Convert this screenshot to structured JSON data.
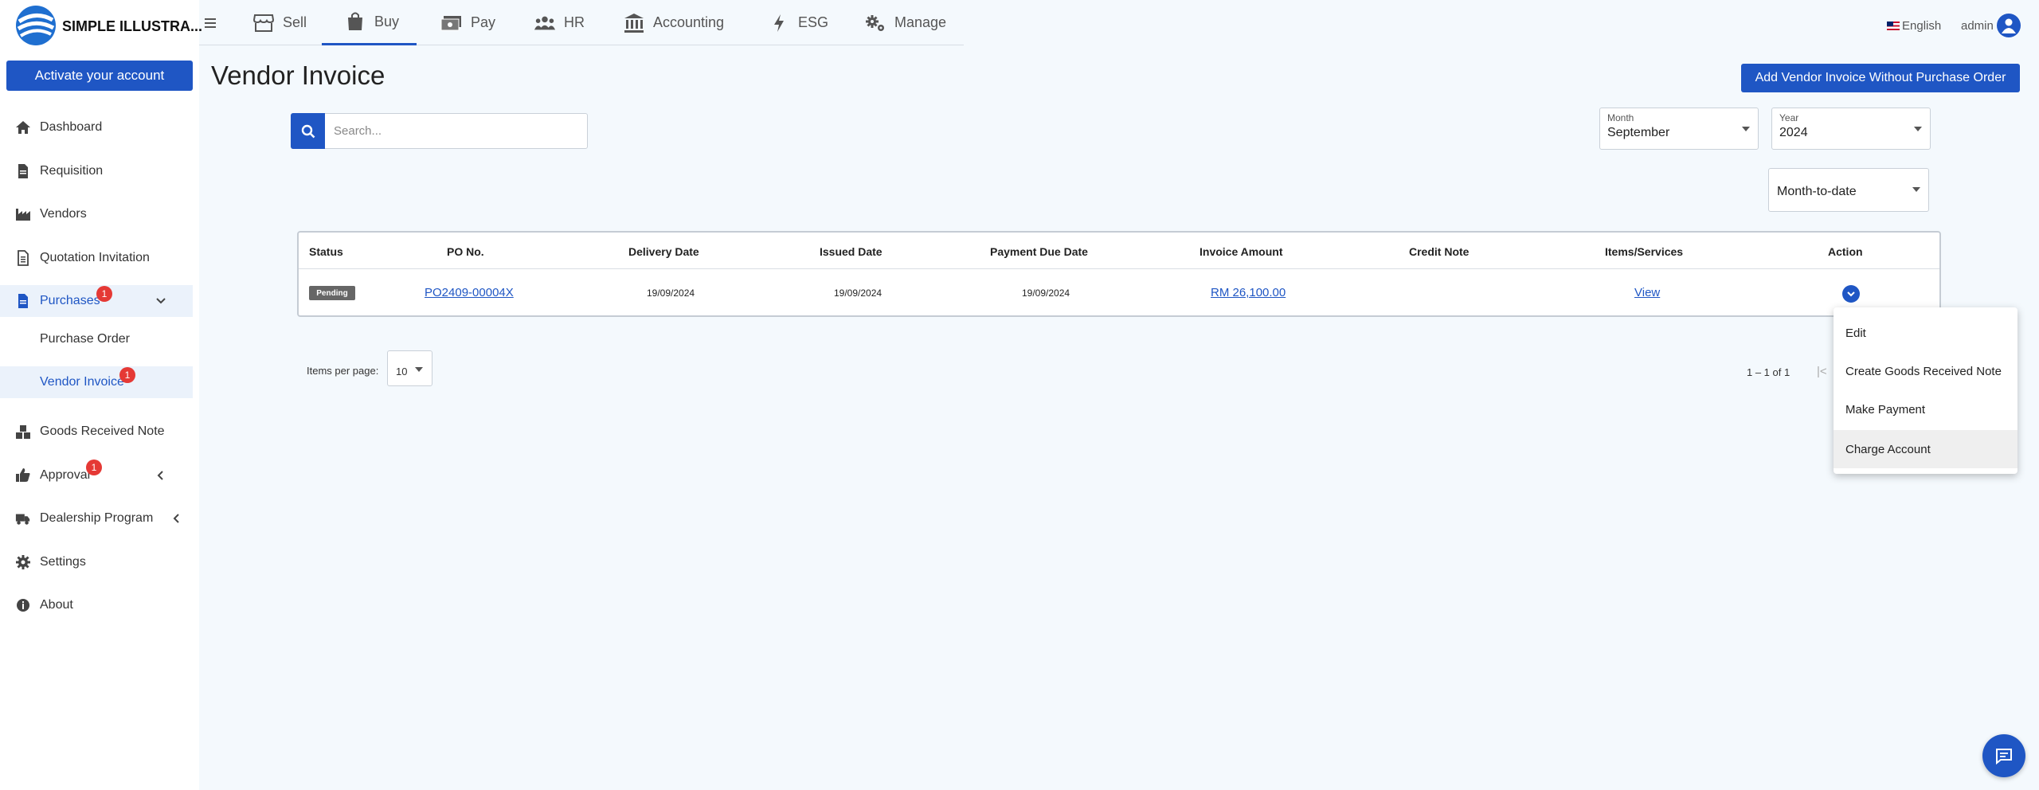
{
  "brand": {
    "name": "SIMPLE ILLUSTRA..."
  },
  "sidebar": {
    "activate_label": "Activate your account",
    "items": [
      {
        "label": "Dashboard",
        "icon": "home-icon"
      },
      {
        "label": "Requisition",
        "icon": "document-icon"
      },
      {
        "label": "Vendors",
        "icon": "factory-icon"
      },
      {
        "label": "Quotation Invitation",
        "icon": "quotation-icon"
      },
      {
        "label": "Purchases",
        "icon": "purchase-icon",
        "badge": "1"
      },
      {
        "label": "Goods Received Note",
        "icon": "boxes-icon"
      },
      {
        "label": "Approval",
        "icon": "thumbs-up-icon",
        "badge": "1"
      },
      {
        "label": "Dealership Program",
        "icon": "truck-icon"
      },
      {
        "label": "Settings",
        "icon": "gear-icon"
      },
      {
        "label": "About",
        "icon": "info-icon"
      }
    ],
    "sub_items": [
      {
        "label": "Purchase Order"
      },
      {
        "label": "Vendor Invoice",
        "badge": "1"
      }
    ]
  },
  "topnav": {
    "items": [
      {
        "label": "Sell",
        "icon": "store-icon"
      },
      {
        "label": "Buy",
        "icon": "shopping-bag-icon"
      },
      {
        "label": "Pay",
        "icon": "money-icon"
      },
      {
        "label": "HR",
        "icon": "people-icon"
      },
      {
        "label": "Accounting",
        "icon": "bank-icon"
      },
      {
        "label": "ESG",
        "icon": "bolt-icon"
      },
      {
        "label": "Manage",
        "icon": "gears-icon"
      }
    ],
    "language": "English",
    "user": "admin"
  },
  "page": {
    "title": "Vendor Invoice",
    "add_button": "Add Vendor Invoice Without Purchase Order",
    "search_placeholder": "Search..."
  },
  "filters": {
    "month": {
      "caption": "Month",
      "value": "September"
    },
    "year": {
      "caption": "Year",
      "value": "2024"
    },
    "period": {
      "value": "Month-to-date"
    }
  },
  "table": {
    "columns": [
      "Status",
      "PO No.",
      "Delivery Date",
      "Issued Date",
      "Payment Due Date",
      "Invoice Amount",
      "Credit Note",
      "Items/Services",
      "Action"
    ],
    "rows": [
      {
        "status": "Pending",
        "po_no": "PO2409-00004X",
        "delivery_date": "19/09/2024",
        "issued_date": "19/09/2024",
        "payment_due_date": "19/09/2024",
        "invoice_amount": "RM 26,100.00",
        "credit_note": "",
        "items": "View"
      }
    ]
  },
  "paginator": {
    "items_per_page_label": "Items per page:",
    "items_per_page": "10",
    "range": "1 – 1 of 1",
    "first_page": "|<"
  },
  "action_menu": {
    "items": [
      "Edit",
      "Create Goods Received Note",
      "Make Payment",
      "Charge Account"
    ]
  },
  "colors": {
    "primary": "#1f56c4",
    "badge": "#e53935",
    "background": "#f4f9fd"
  }
}
